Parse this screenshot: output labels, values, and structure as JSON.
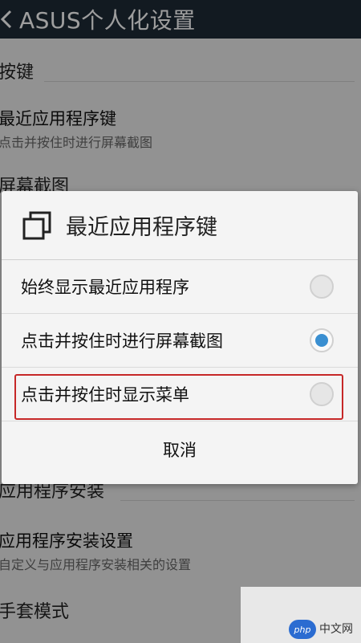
{
  "app_bar": {
    "title": "ASUS个人化设置",
    "back_icon": "chevron-left-icon"
  },
  "settings": {
    "sections": [
      {
        "header": "按键"
      },
      {
        "header": "屏幕截图"
      },
      {
        "header": "应用程序安装"
      },
      {
        "header": "手套模式"
      }
    ],
    "items": [
      {
        "title": "最近应用程序键",
        "subtitle": "点击并按住时进行屏幕截图"
      },
      {
        "title": "应用程序安装设置",
        "subtitle": "自定义与应用程序安装相关的设置"
      }
    ]
  },
  "dialog": {
    "icon": "recent-apps-icon",
    "title": "最近应用程序键",
    "options": [
      {
        "label": "始终显示最近应用程序",
        "selected": false
      },
      {
        "label": "点击并按住时进行屏幕截图",
        "selected": true
      },
      {
        "label": "点击并按住时显示菜单",
        "selected": false,
        "highlighted": true
      }
    ],
    "cancel_label": "取消"
  },
  "colors": {
    "app_bar": "#1e2a36",
    "radio_selected": "#3a8fd1",
    "highlight": "#c62828"
  },
  "watermark": {
    "badge": "php",
    "text": "中文网"
  }
}
